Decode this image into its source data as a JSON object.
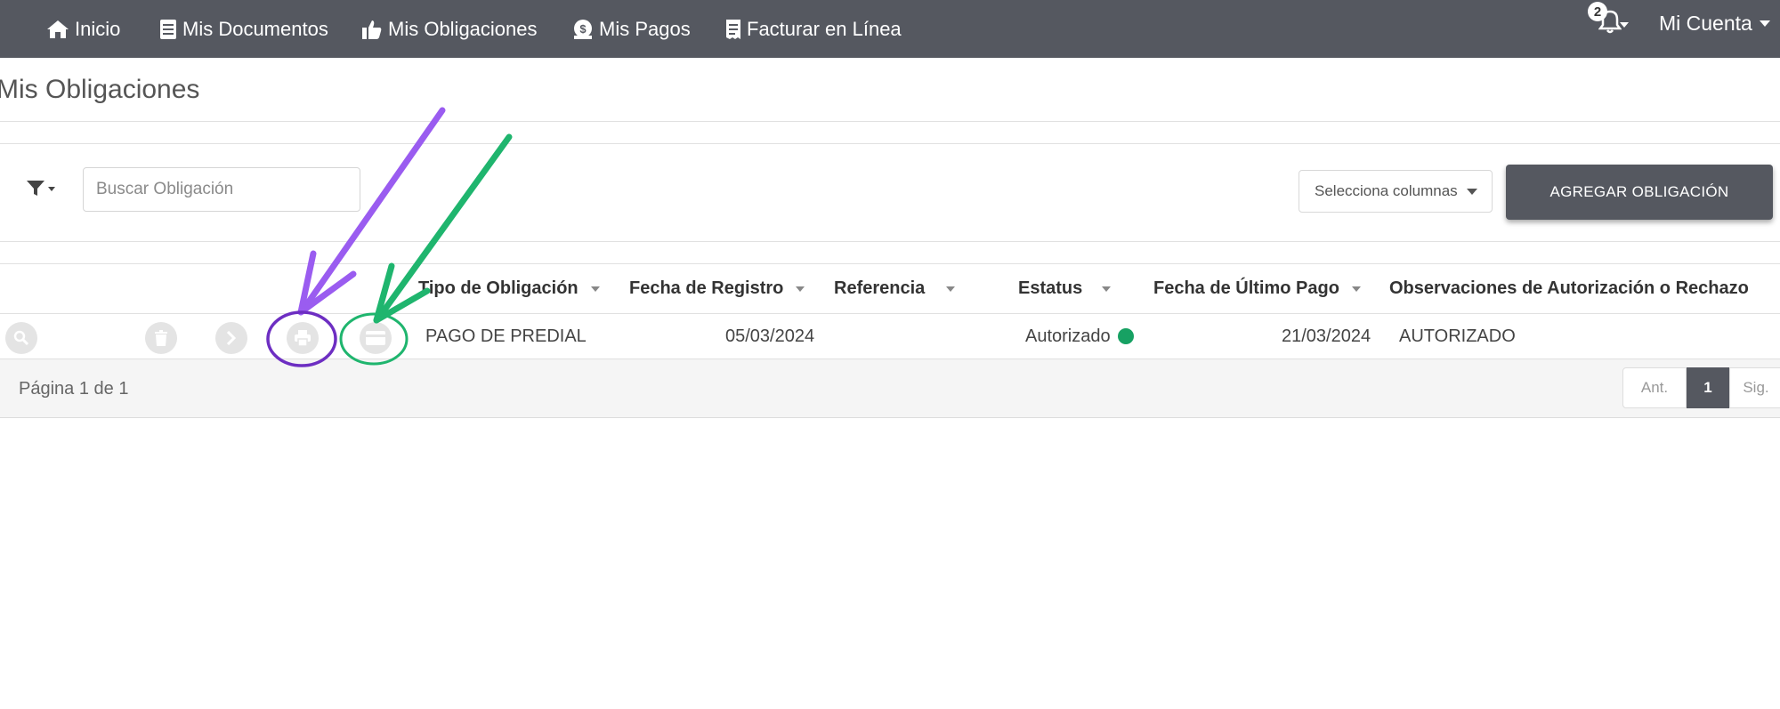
{
  "nav": {
    "items": [
      {
        "label": "Inicio",
        "icon": "home-icon"
      },
      {
        "label": "Mis Documentos",
        "icon": "document-icon"
      },
      {
        "label": "Mis Obligaciones",
        "icon": "thumbs-up-icon"
      },
      {
        "label": "Mis Pagos",
        "icon": "money-icon"
      },
      {
        "label": "Facturar en Línea",
        "icon": "receipt-icon"
      }
    ],
    "notifications_count": "2",
    "account_label": "Mi Cuenta"
  },
  "page": {
    "title": "Mis Obligaciones"
  },
  "toolbar": {
    "search_placeholder": "Buscar Obligación",
    "columns_select_label": "Selecciona columnas",
    "add_button_label": "AGREGAR OBLIGACIÓN"
  },
  "table": {
    "columns": [
      "Tipo de Obligación",
      "Fecha de Registro",
      "Referencia",
      "Estatus",
      "Fecha de Último Pago",
      "Observaciones de Autorización o Rechazo"
    ],
    "rows": [
      {
        "tipo": "PAGO DE PREDIAL",
        "fecha_registro": "05/03/2024",
        "referencia": "",
        "estatus": "Autorizado",
        "fecha_ultimo_pago": "21/03/2024",
        "observaciones": "AUTORIZADO"
      }
    ],
    "row_actions": [
      "search-icon",
      "trash-icon",
      "chevron-right-icon",
      "print-icon",
      "credit-card-icon"
    ]
  },
  "pagination": {
    "info": "Página 1 de 1",
    "prev_label": "Ant.",
    "current_page": "1",
    "next_label": "Sig."
  },
  "colors": {
    "navbar": "#555860",
    "status_ok": "#17a163",
    "annotation_purple": "#9a5cf0",
    "annotation_green": "#1fb56e"
  }
}
